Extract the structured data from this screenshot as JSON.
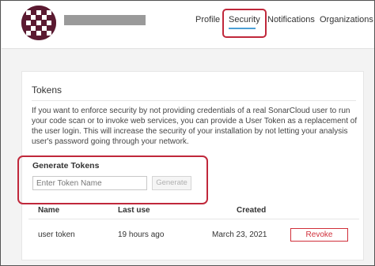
{
  "header": {
    "nav": [
      {
        "label": "Profile",
        "active": false
      },
      {
        "label": "Security",
        "active": true
      },
      {
        "label": "Notifications",
        "active": false
      },
      {
        "label": "Organizations",
        "active": false
      }
    ]
  },
  "tokens": {
    "title": "Tokens",
    "description": "If you want to enforce security by not providing credentials of a real SonarCloud user to run your code scan or to invoke web services, you can provide a User Token as a replacement of the user login. This will increase the security of your installation by not letting your analysis user's password going through your network.",
    "generate": {
      "title": "Generate Tokens",
      "input_placeholder": "Enter Token Name",
      "input_value": "",
      "button_label": "Generate"
    },
    "table": {
      "columns": [
        "Name",
        "Last use",
        "Created"
      ],
      "rows": [
        {
          "name": "user token",
          "last_use": "19 hours ago",
          "created": "March 23, 2021",
          "action": "Revoke"
        }
      ]
    }
  },
  "colors": {
    "annotation": "#c0283b",
    "active_underline": "#4b9fd5",
    "revoke": "#d02f3a",
    "avatar": "#5b1a31"
  }
}
